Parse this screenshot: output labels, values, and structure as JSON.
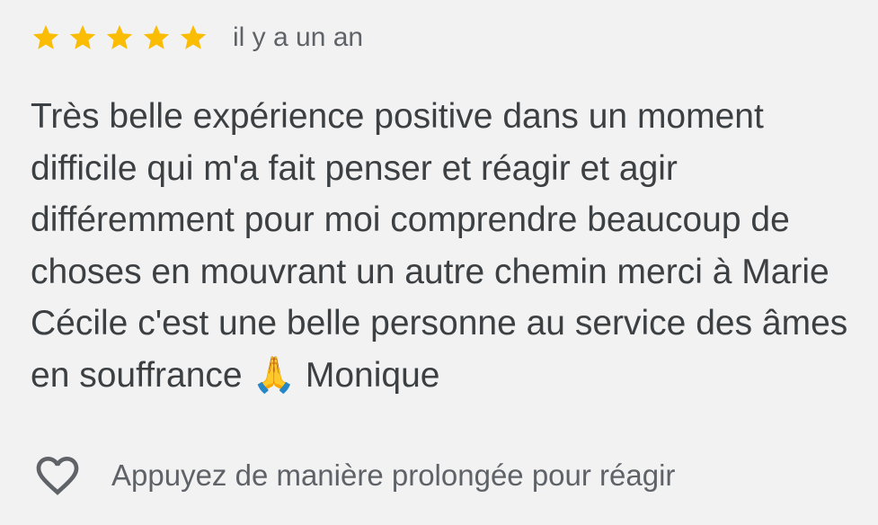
{
  "review": {
    "rating": 5,
    "rating_max": 5,
    "stars": [
      {
        "icon": "star-filled-icon"
      },
      {
        "icon": "star-filled-icon"
      },
      {
        "icon": "star-filled-icon"
      },
      {
        "icon": "star-filled-icon"
      },
      {
        "icon": "star-filled-icon"
      }
    ],
    "date": "il y a un an",
    "text": "Très belle expérience positive dans un moment difficile qui m'a fait penser et réagir et agir différemment pour moi comprendre beaucoup de choses en mouvrant un autre chemin merci à Marie Cécile c'est une belle personne au service des âmes en souffrance 🙏 Monique",
    "reaction": {
      "icon": "heart-outline-icon",
      "hint": "Appuyez de manière prolongée pour réagir"
    }
  },
  "colors": {
    "background": "#f2f2f2",
    "star": "#fbbc04",
    "text": "#3c4043",
    "secondary_text": "#5f6368",
    "heart": "#5f6368"
  }
}
